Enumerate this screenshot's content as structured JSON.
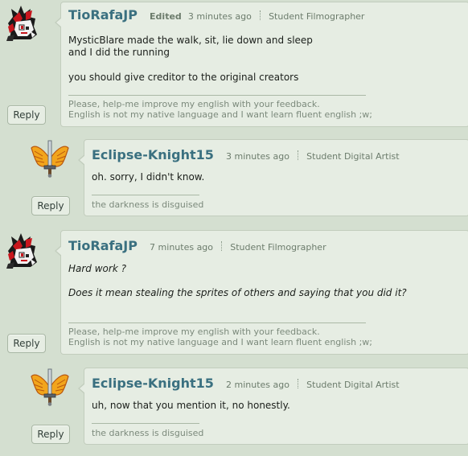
{
  "comments": [
    {
      "username": "TioRafaJP",
      "edited": "Edited",
      "time": "3 minutes ago",
      "role": "Student Filmographer",
      "lines": [
        "MysticBlare made the walk, sit, lie down and sleep",
        "and I did the running",
        "you should give creditor to the original creators"
      ],
      "signature": [
        "Please, help-me improve my english with your feedback.",
        "English is not my native language and I want learn fluent english ;w;"
      ],
      "reply_label": "Reply"
    },
    {
      "username": "Eclipse-Knight15",
      "time": "3 minutes ago",
      "role": "Student Digital Artist",
      "lines": [
        "oh. sorry, I didn't know."
      ],
      "signature": [
        "the darkness is disguised"
      ],
      "reply_label": "Reply"
    },
    {
      "username": "TioRafaJP",
      "time": "7 minutes ago",
      "role": "Student Filmographer",
      "lines": [
        "Hard work ?",
        "Does it mean stealing the sprites of others and saying that you did it?"
      ],
      "signature": [
        "Please, help-me improve my english with your feedback.",
        "English is not my native language and I want learn fluent english ;w;"
      ],
      "reply_label": "Reply"
    },
    {
      "username": "Eclipse-Knight15",
      "time": "2 minutes ago",
      "role": "Student Digital Artist",
      "lines": [
        "uh, now that you mention it, no honestly."
      ],
      "signature": [
        "the darkness is disguised"
      ],
      "reply_label": "Reply"
    }
  ],
  "icons": {
    "tiorafa_avatar": "red-black-pony-avatar-icon",
    "eclipse_avatar": "winged-sword-avatar-icon"
  }
}
